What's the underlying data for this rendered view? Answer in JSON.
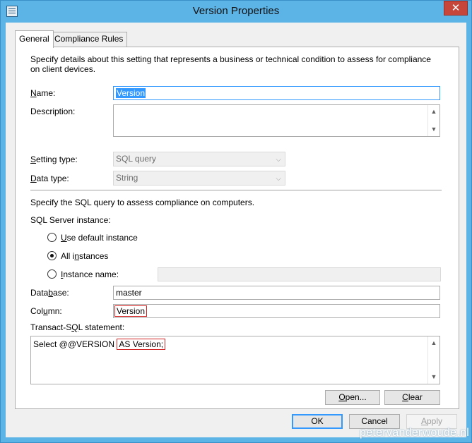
{
  "window": {
    "title": "Version Properties",
    "close_glyph": "✕",
    "icon": "window-properties-icon"
  },
  "tabs": [
    {
      "label": "General",
      "active": true
    },
    {
      "label": "Compliance Rules",
      "active": false
    }
  ],
  "general": {
    "description_text": "Specify details about this setting that represents a business or technical condition to assess for compliance on client devices.",
    "name_label": "Name:",
    "name_value": "Version",
    "description_label": "Description:",
    "description_value": "",
    "setting_type_label": "Setting type:",
    "setting_type_value": "SQL query",
    "data_type_label": "Data type:",
    "data_type_value": "String",
    "sql_intro": "Specify the SQL query to assess compliance on computers.",
    "instance_label": "SQL Server instance:",
    "radio_default": "Use default instance",
    "radio_all": "All instances",
    "radio_named": "Instance name:",
    "selected_instance": "All instances",
    "instance_name_value": "",
    "database_label": "Database:",
    "database_value": "master",
    "column_label": "Column:",
    "column_value": "Version",
    "tsql_label": "Transact-SQL statement:",
    "tsql_part1": "Select @@VERSION ",
    "tsql_part2": "AS Version;",
    "open_button": "Open...",
    "clear_button": "Clear"
  },
  "footer": {
    "ok": "OK",
    "cancel": "Cancel",
    "apply": "Apply"
  },
  "watermark": "petervanderwoude.nl",
  "colors": {
    "titlebar": "#5cb3e6",
    "close": "#c7463c",
    "selection": "#3399ff",
    "highlight_box": "#d02020"
  }
}
